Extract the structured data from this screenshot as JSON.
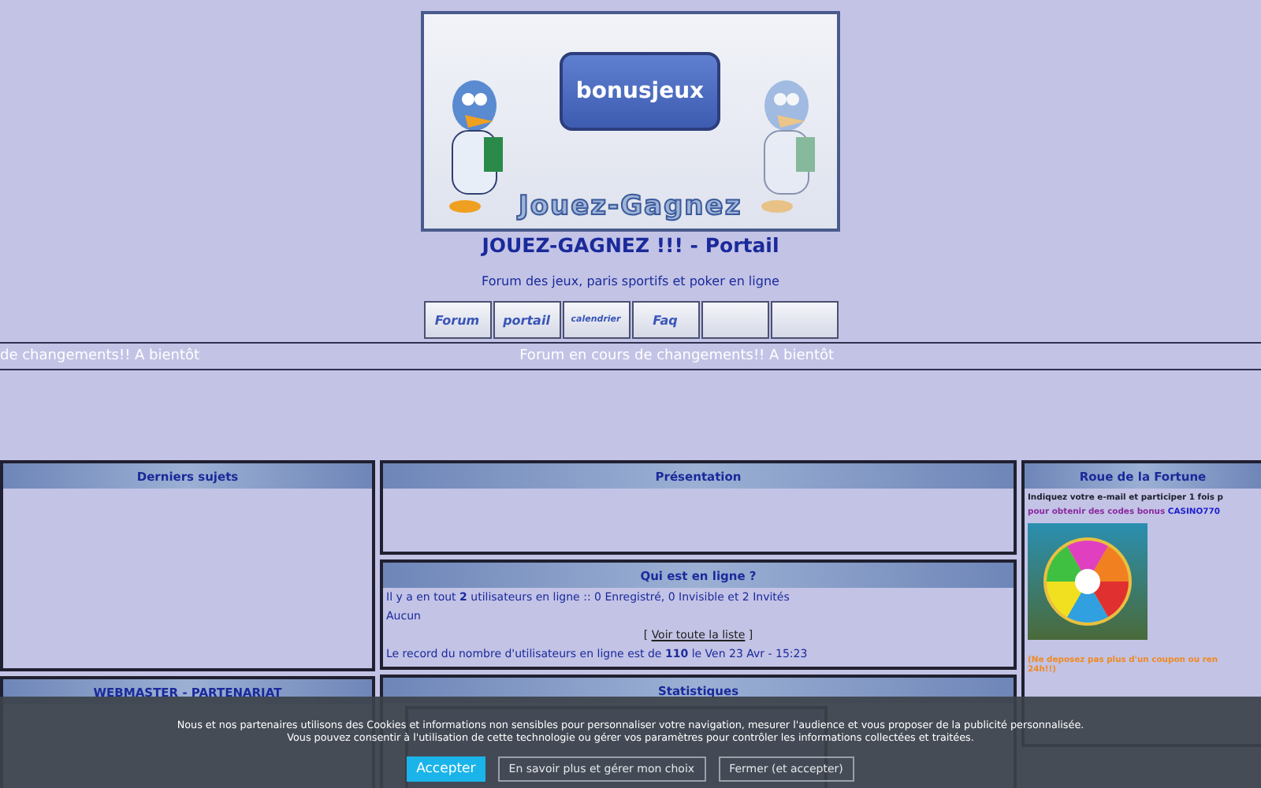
{
  "banner": {
    "bubble_text": "bonusjeux",
    "slogan": "Jouez-Gagnez"
  },
  "site_title": "JOUEZ-GAGNEZ !!! - Portail",
  "site_description": "Forum des jeux, paris sportifs et poker en ligne",
  "nav_buttons": [
    {
      "kind": "labeled",
      "label": "Forum"
    },
    {
      "kind": "labeled",
      "label": "portail"
    },
    {
      "kind": "labeled",
      "label": "calendrier"
    },
    {
      "kind": "labeled",
      "label": "Faq"
    },
    {
      "kind": "blank"
    },
    {
      "kind": "blank"
    }
  ],
  "marquee": [
    "de changements!! A bientôt",
    "Forum en cours de changements!! A bientôt"
  ],
  "left_column": [
    {
      "title": "Derniers sujets"
    },
    {
      "title": "WEBMASTER - PARTENARIAT"
    }
  ],
  "presentation": {
    "title": "Présentation"
  },
  "who_is_online": {
    "title": "Qui est en ligne ?",
    "summary": "Il y a en tout **2** utilisateurs en ligne :: 0 Enregistré, 0 Invisible et 2 Invités",
    "members": "Aucun",
    "list_link_open": "[",
    "list_link": "Voir toute la liste",
    "list_link_close": "]",
    "record": "Le record du nombre d'utilisateurs en ligne est de **110** le Ven 23 Avr - 15:23"
  },
  "statistics": {
    "title": "Statistiques"
  },
  "fortune_wheel": {
    "title": "Roue de la Fortune",
    "instruction": "Indiquez votre e-mail et participer 1 fois p",
    "bonus_text": "pour obtenir des codes bonus",
    "bonus_code": "CASINO770",
    "warning_lines": [
      "(Ne deposez pas plus d'un coupon ou ren",
      "24h!!)"
    ]
  },
  "cookie_banner": {
    "text_lines": [
      "Nous et nos partenaires utilisons des Cookies et informations non sensibles pour personnaliser votre navigation, mesurer l'audience et vous proposer de la publicité personnalisée.",
      "Vous pouvez consentir à l'utilisation de cette technologie ou gérer vos paramètres pour contrôler les informations collectées et traitées."
    ],
    "buttons": [
      {
        "kind": "primary",
        "label": "Accepter"
      },
      {
        "kind": "secondary",
        "label": "En savoir plus et gérer mon choix"
      },
      {
        "kind": "secondary",
        "label": "Fermer (et accepter)"
      }
    ]
  }
}
